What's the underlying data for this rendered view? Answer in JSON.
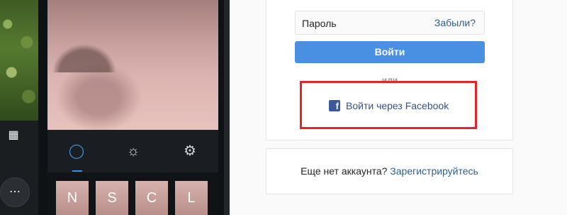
{
  "login": {
    "password_placeholder": "Пароль",
    "forgot_link": "Забыли?",
    "login_button": "Войти",
    "or_separator": "или",
    "facebook_login": "Войти через Facebook"
  },
  "signup": {
    "prompt": "Еще нет аккаунта?",
    "link": "Зарегистрируйтесь"
  },
  "phone": {
    "filters": [
      "N",
      "S",
      "C",
      "L"
    ],
    "tools": [
      "adjust-icon",
      "brightness-icon",
      "tune-icon"
    ]
  },
  "colors": {
    "primary_button": "#4a90e2",
    "link": "#2d5f8a",
    "facebook": "#3b5998",
    "highlight_border": "#e0262d"
  }
}
